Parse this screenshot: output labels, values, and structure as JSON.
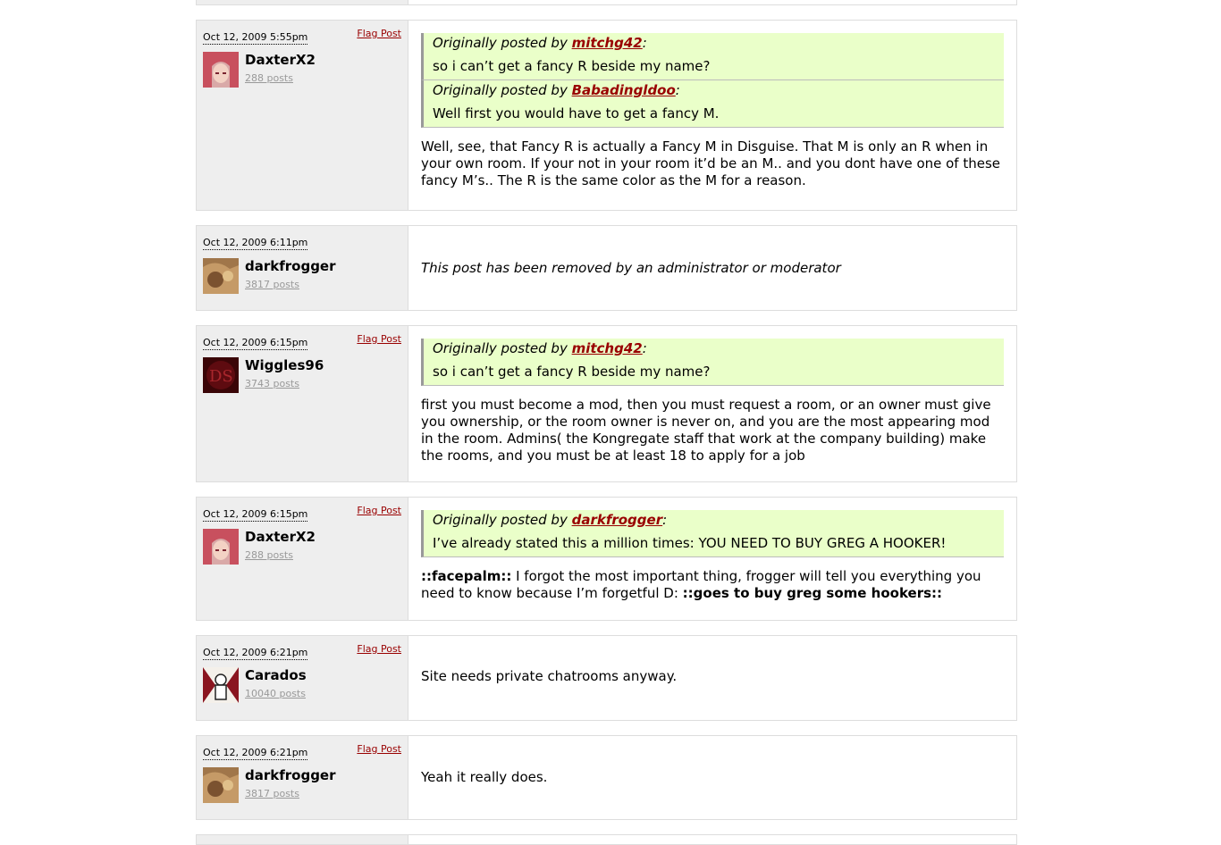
{
  "flag_label": "Flag Post",
  "posts": [
    {
      "date": "Oct 12, 2009 5:55pm",
      "user": "DaxterX2",
      "count": "288 posts",
      "quotes": [
        {
          "prefix": "Originally posted by ",
          "author": "mitchg42",
          "text": "so i can’t get a fancy R beside my name?"
        },
        {
          "prefix": "Originally posted by ",
          "author": "Babadingldoo",
          "text": "Well first you would have to get a fancy M."
        }
      ],
      "text": "Well, see, that Fancy R is actually a Fancy M in Disguise. That M is only an R when in your own room. If your not in your room it’d be an M.. and you dont have one of these fancy M’s.. The R is the same color as the M for a reason."
    },
    {
      "date": "Oct 12, 2009 6:11pm",
      "user": "darkfrogger",
      "count": "3817 posts",
      "removed": "This post has been removed by an administrator or moderator"
    },
    {
      "date": "Oct 12, 2009 6:15pm",
      "user": "Wiggles96",
      "count": "3743 posts",
      "quotes": [
        {
          "prefix": "Originally posted by ",
          "author": "mitchg42",
          "text": "so i can’t get a fancy R beside my name?"
        }
      ],
      "text": "first you must become a mod, then you must request a room, or an owner must give you ownership, or the room owner is never on, and you are the most appearing mod in the room. Admins( the Kongregate staff that work at the company building) make the rooms, and you must be at least 18 to apply for a job"
    },
    {
      "date": "Oct 12, 2009 6:15pm",
      "user": "DaxterX2",
      "count": "288 posts",
      "quotes": [
        {
          "prefix": "Originally posted by ",
          "author": "darkfrogger",
          "text": "I’ve already stated this a million times: YOU NEED TO BUY GREG A HOOKER!"
        }
      ],
      "text_parts": {
        "b1": "::facepalm::",
        "mid": " I forgot the most important thing, frogger will tell you everything you need to know because I’m forgetful D: ",
        "b2": "::goes to buy greg some hookers::"
      }
    },
    {
      "date": "Oct 12, 2009 6:21pm",
      "user": "Carados",
      "count": "10040 posts",
      "text": "Site needs private chatrooms anyway."
    },
    {
      "date": "Oct 12, 2009 6:21pm",
      "user": "darkfrogger",
      "count": "3817 posts",
      "text": "Yeah it really does."
    }
  ],
  "colors": {
    "quote_bg": "#eaffc9",
    "link": "#990000",
    "side_bg": "#eeeeee"
  }
}
